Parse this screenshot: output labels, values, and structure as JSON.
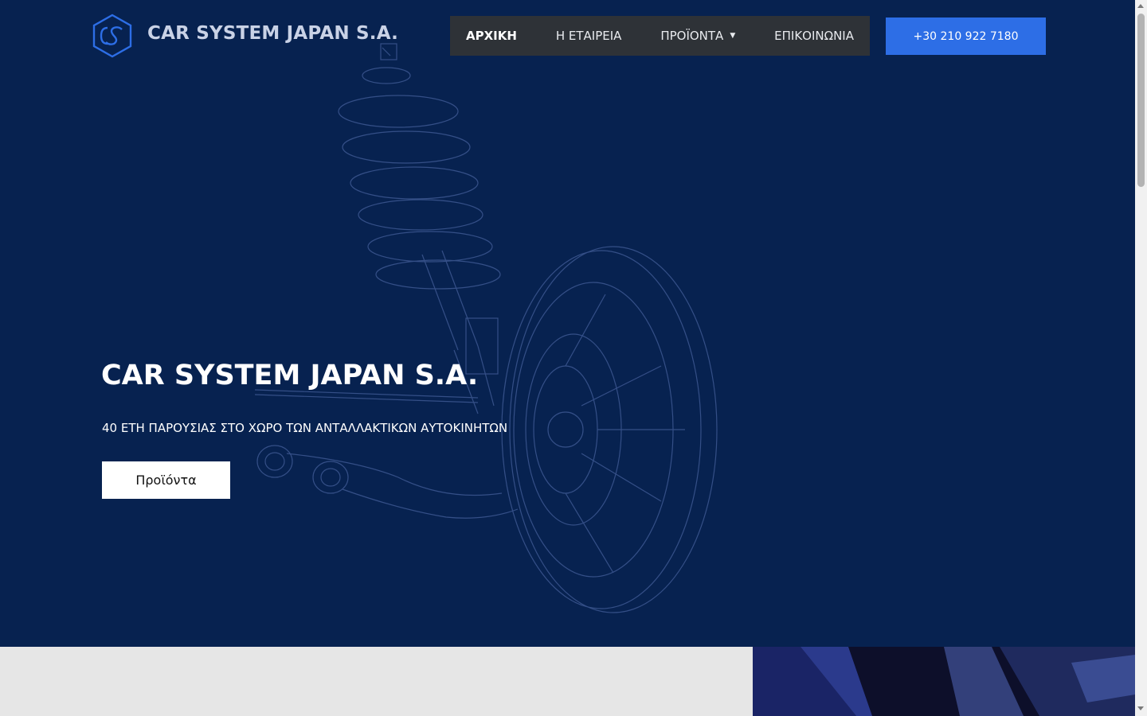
{
  "colors": {
    "hero_background": "#072250",
    "nav_background": "#2e3237",
    "phone_button": "#2d6ee6",
    "logo_text": "#c9d2e6",
    "lower_section": "#e6e6e6"
  },
  "header": {
    "logo_icon": "cs-hexagon-logo-icon",
    "logo_text": "CAR SYSTEM JAPAN S.A."
  },
  "nav": {
    "items": [
      {
        "label": "ΑΡΧΙΚΗ",
        "active": true
      },
      {
        "label": "Η ΕΤΑΙΡΕΙΑ",
        "active": false
      },
      {
        "label": "ΠΡΟΪΟΝΤΑ",
        "active": false,
        "dropdown": true
      },
      {
        "label": "ΕΠΙΚΟΙΝΩΝΙΑ",
        "active": false
      }
    ],
    "dropdown_icon": "caret-down-icon"
  },
  "phone_button": {
    "label": "+30 210 922 7180"
  },
  "hero": {
    "title": "CAR SYSTEM JAPAN S.A.",
    "subtitle": "40 ΕΤΗ ΠΑΡΟΥΣΙΑΣ ΣΤΟ ΧΩΡΟ ΤΩΝ ΑΝΤΑΛΛΑΚΤΙΚΩΝ ΑΥΤΟΚΙΝΗΤΩΝ",
    "button_label": "Προϊόντα",
    "background_image": "wireframe-suspension-wheel"
  }
}
